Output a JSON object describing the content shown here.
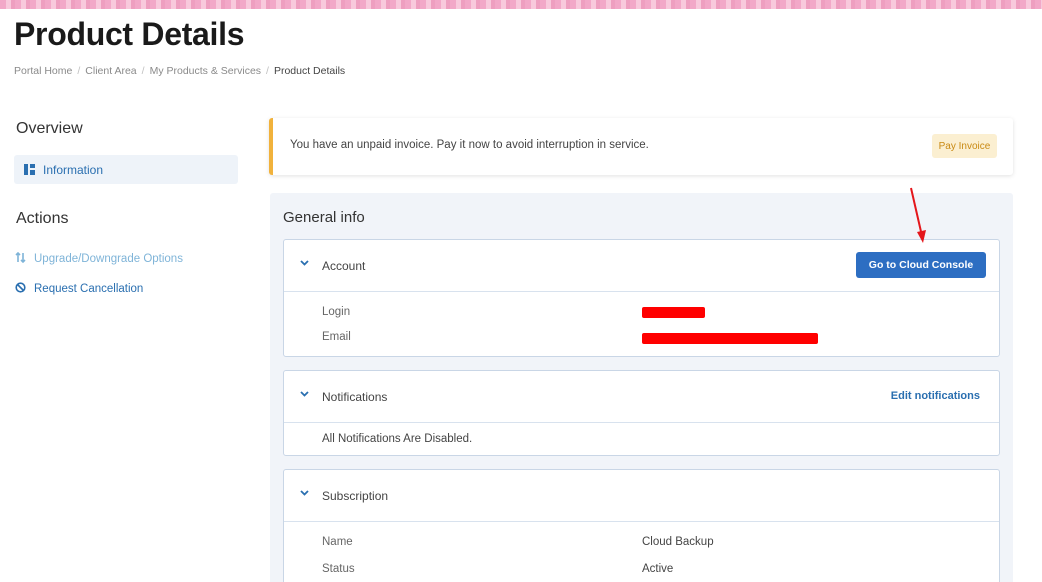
{
  "page": {
    "title": "Product Details",
    "breadcrumb": [
      "Portal Home",
      "Client Area",
      "My Products & Services",
      "Product Details"
    ]
  },
  "sidebar": {
    "overview_heading": "Overview",
    "overview_items": [
      {
        "label": "Information",
        "icon": "dashboard-icon"
      }
    ],
    "actions_heading": "Actions",
    "actions_items": [
      {
        "label": "Upgrade/Downgrade Options",
        "icon": "sort-arrows-icon"
      },
      {
        "label": "Request Cancellation",
        "icon": "ban-icon"
      }
    ]
  },
  "alert": {
    "message": "You have an unpaid invoice. Pay it now to avoid interruption in service.",
    "button_label": "Pay Invoice",
    "accent_color": "#f1b23c"
  },
  "general_info": {
    "title": "General info",
    "account": {
      "title": "Account",
      "button_label": "Go to Cloud Console",
      "rows": [
        {
          "label": "Login",
          "value_redacted": true
        },
        {
          "label": "Email",
          "value_redacted": true
        }
      ]
    },
    "notifications": {
      "title": "Notifications",
      "link_label": "Edit notifications",
      "text": "All Notifications Are Disabled."
    },
    "subscription": {
      "title": "Subscription",
      "rows": [
        {
          "label": "Name",
          "value": "Cloud Backup"
        },
        {
          "label": "Status",
          "value": "Active"
        }
      ]
    }
  },
  "colors": {
    "primary": "#2d6ec2",
    "link": "#2a6fb0",
    "redaction": "#ff0000",
    "panel_bg": "#f1f4f9"
  }
}
